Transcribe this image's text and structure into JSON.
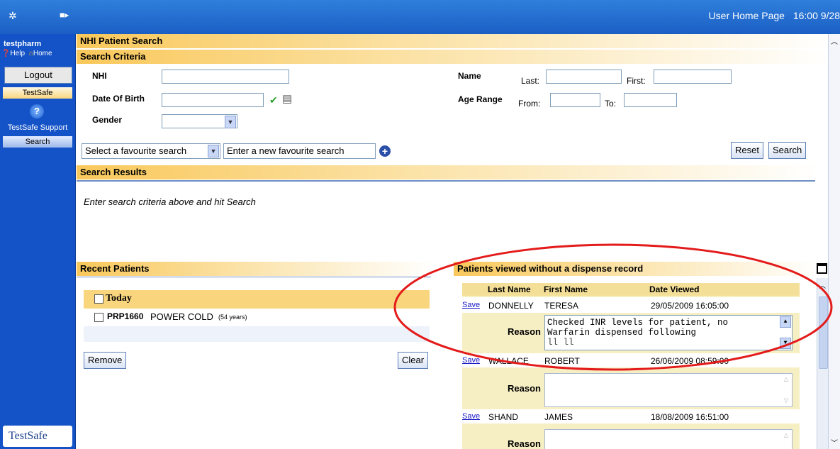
{
  "header": {
    "title": "User Home Page",
    "time": "16:00 9/28"
  },
  "sidebar": {
    "user": "testpharm",
    "help_label": "Help",
    "home_label": "Home",
    "logout_label": "Logout",
    "testsafe_tab": "TestSafe",
    "support_label": "TestSafe Support",
    "search_tab": "Search",
    "logo_text": "TestSafe"
  },
  "page": {
    "title": "NHI Patient Search"
  },
  "search_criteria": {
    "heading": "Search Criteria",
    "nhi_label": "NHI",
    "dob_label": "Date Of Birth",
    "gender_label": "Gender",
    "name_label": "Name",
    "last_label": "Last:",
    "first_label": "First:",
    "age_range_label": "Age Range",
    "from_label": "From:",
    "to_label": "To:",
    "favourite_select": "Select a favourite search",
    "favourite_input": "Enter a new favourite search",
    "reset_label": "Reset",
    "search_label": "Search"
  },
  "search_results": {
    "heading": "Search Results",
    "message": "Enter search criteria above and hit Search"
  },
  "recent_patients": {
    "heading": "Recent Patients",
    "group_label": "Today",
    "patient_id": "PRP1660",
    "patient_name": "POWER COLD",
    "patient_age": "(54 years)",
    "remove_label": "Remove",
    "clear_label": "Clear"
  },
  "no_dispense": {
    "heading": "Patients viewed without a dispense record",
    "columns": [
      "Last Name",
      "First Name",
      "Date Viewed"
    ],
    "save_label": "Save",
    "reason_label": "Reason",
    "rows": [
      {
        "last": "DONNELLY",
        "first": "TERESA",
        "date": "29/05/2009 16:05:00",
        "reason_line1": "Checked INR levels for patient, no",
        "reason_line2": "Warfarin dispensed following",
        "reason_line3": "ll                 ll"
      },
      {
        "last": "WALLACE",
        "first": "ROBERT",
        "date": "26/06/2009 08:59:00",
        "reason_line1": "",
        "reason_line2": "",
        "reason_line3": ""
      },
      {
        "last": "SHAND",
        "first": "JAMES",
        "date": "18/08/2009 16:51:00",
        "reason_line1": "",
        "reason_line2": "",
        "reason_line3": ""
      }
    ]
  },
  "colors": {
    "topbar": "#1b5fc4",
    "sidebar": "#1453c7",
    "section_header": "#f9c85b",
    "annotation": "#e31b1b"
  }
}
